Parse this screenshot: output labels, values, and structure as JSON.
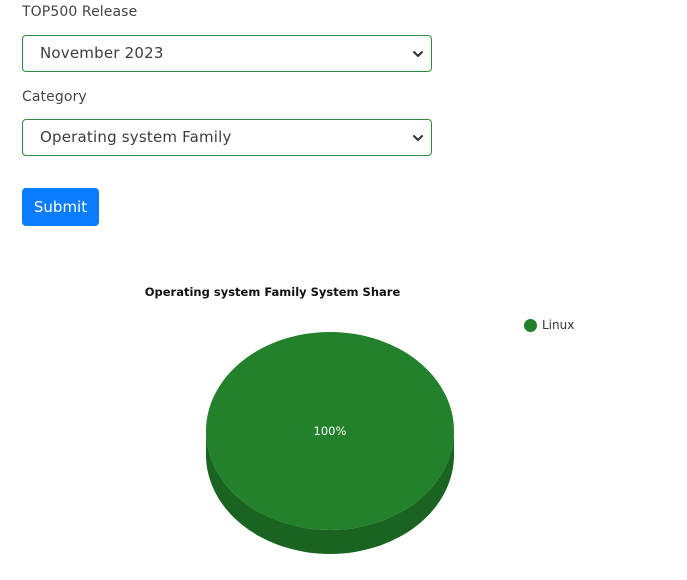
{
  "form": {
    "release_label": "TOP500 Release",
    "release_value": "November 2023",
    "category_label": "Category",
    "category_value": "Operating system Family",
    "submit_label": "Submit"
  },
  "colors": {
    "field_border": "#2e8b3e",
    "submit_bg": "#0a7cff",
    "slice_top": "#23802b",
    "slice_side": "#1a6321"
  },
  "icons": {
    "select_arrow": "chevron-down-icon",
    "legend_marker": "legend-dot"
  },
  "chart_data": {
    "type": "pie",
    "title": "Operating system Family System Share",
    "slices": [
      {
        "label": "Linux",
        "value": 100,
        "display": "100%",
        "color": "#23802b"
      }
    ],
    "legend_position": "top-right",
    "style": "3d"
  }
}
